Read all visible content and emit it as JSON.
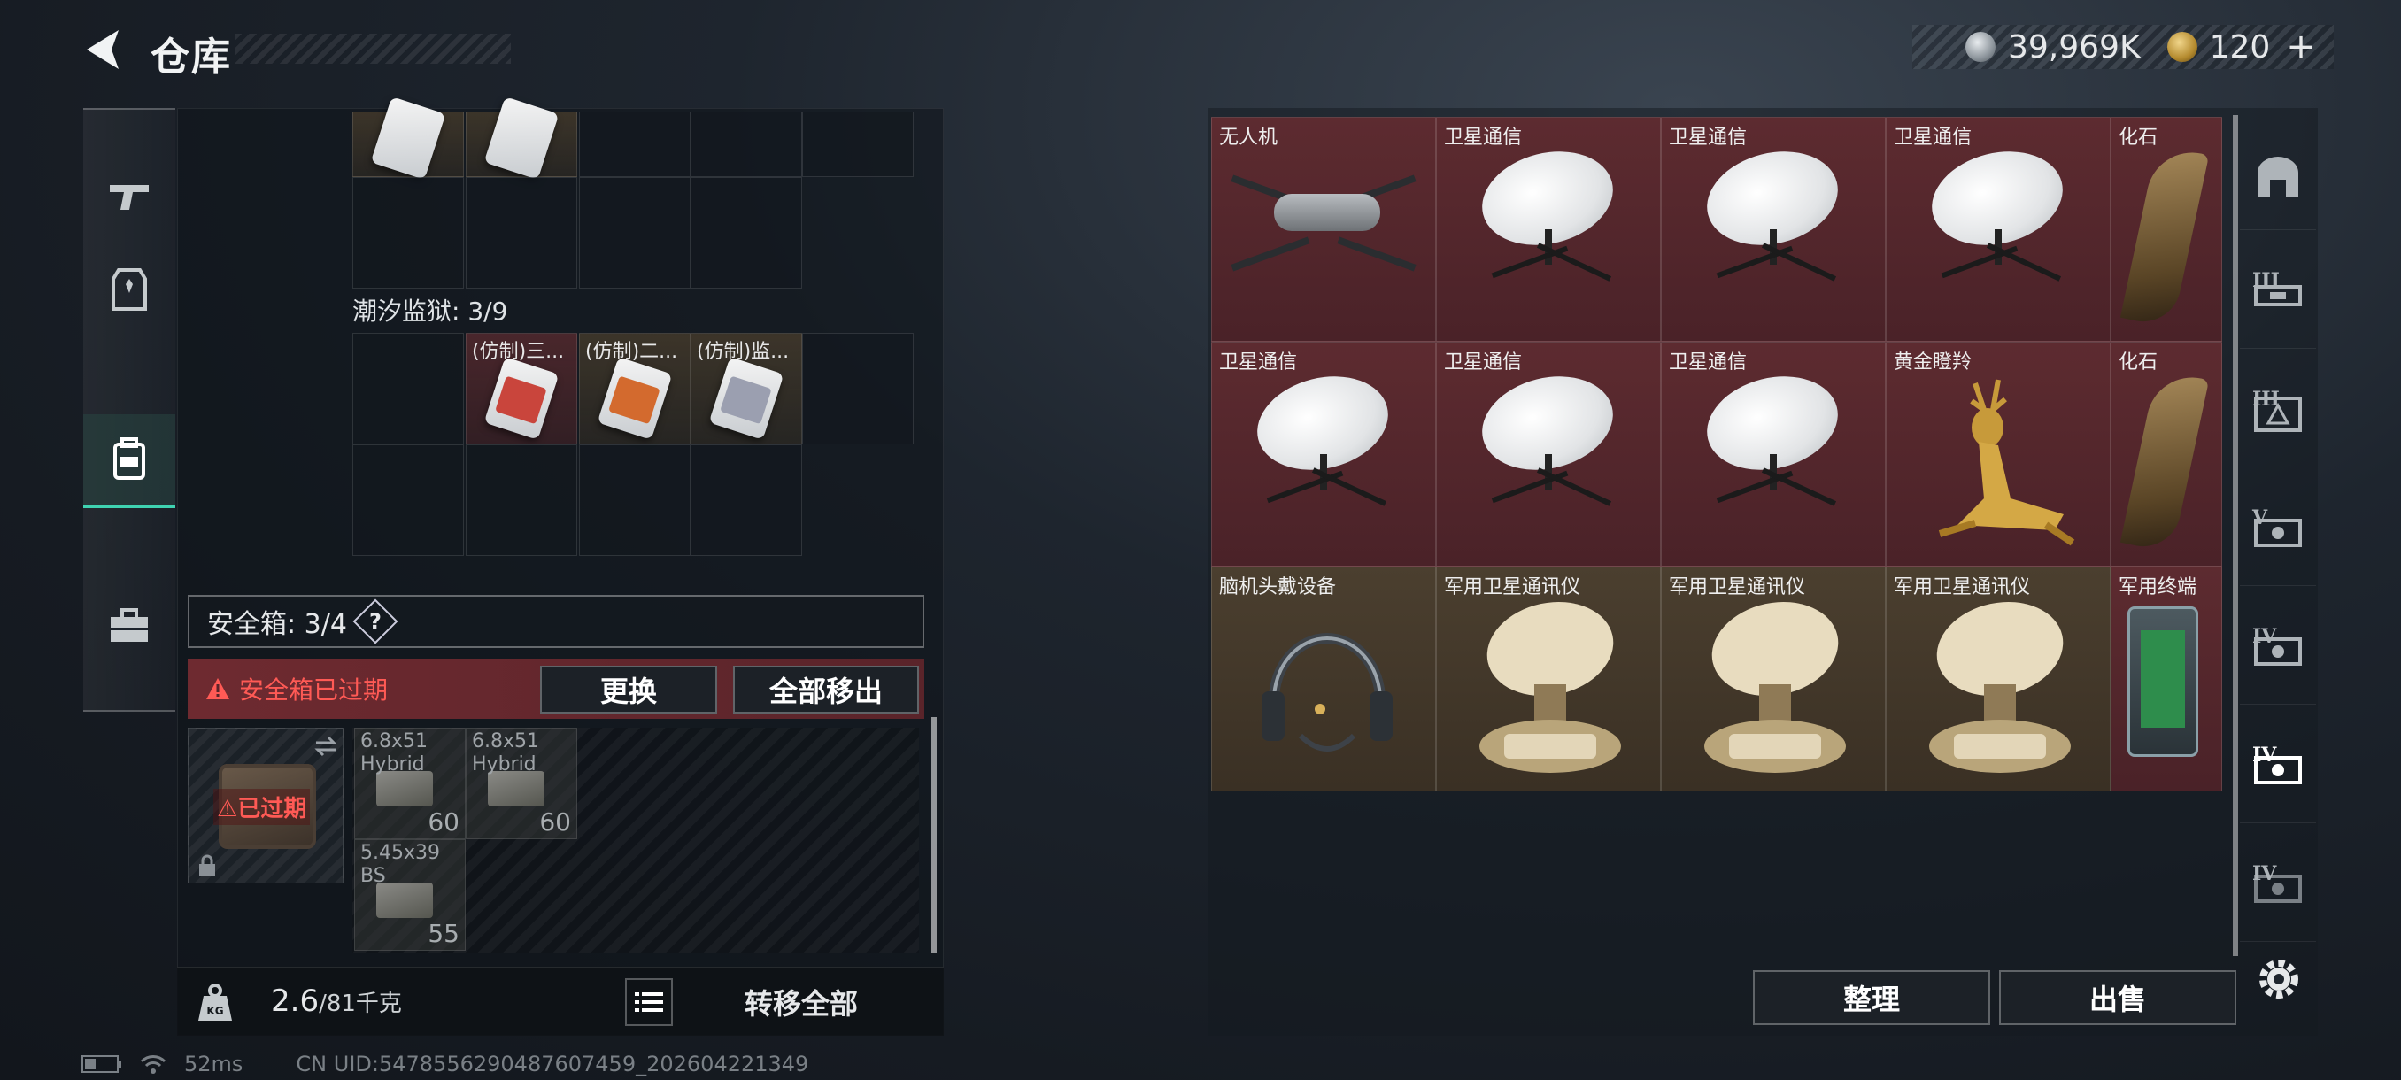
{
  "header": {
    "title": "仓库"
  },
  "currency": {
    "silver": "39,969K",
    "gold": "120"
  },
  "backpack": {
    "tide_prison_label": "潮汐监狱: 3/9",
    "tide_items": [
      "(仿制)三...",
      "(仿制)二...",
      "(仿制)监..."
    ],
    "safebox_label": "安全箱: 3/4",
    "help_label": "?",
    "expired_warning": "安全箱已过期",
    "replace_label": "更换",
    "move_all_out_label": "全部移出",
    "expired_tag": "已过期",
    "ammo": [
      {
        "name": "6.8x51\nHybrid",
        "count": "60"
      },
      {
        "name": "6.8x51\nHybrid",
        "count": "60"
      },
      {
        "name": "5.45x39\nBS",
        "count": "55"
      }
    ],
    "weight_value": "2.6",
    "weight_max": "/81千克",
    "transfer_all_label": "转移全部"
  },
  "status": {
    "ping": "52ms",
    "uid": "CN UID:5478556290487607459_202604221349"
  },
  "warehouse": {
    "items": [
      {
        "name": "无人机"
      },
      {
        "name": "卫星通信"
      },
      {
        "name": "卫星通信"
      },
      {
        "name": "卫星通信"
      },
      {
        "name": "化石"
      },
      {
        "name": "卫星通信"
      },
      {
        "name": "卫星通信"
      },
      {
        "name": "卫星通信"
      },
      {
        "name": "黄金瞪羚"
      },
      {
        "name": "化石"
      },
      {
        "name": "脑机头戴设备"
      },
      {
        "name": "军用卫星通讯仪"
      },
      {
        "name": "军用卫星通讯仪"
      },
      {
        "name": "军用卫星通讯仪"
      },
      {
        "name": "军用终端"
      }
    ],
    "tabs": [
      "",
      "III",
      "III",
      "V",
      "IV",
      "IV",
      "IV"
    ],
    "sort_label": "整理",
    "sell_label": "出售"
  },
  "colors": {
    "accent": "#3fd3b1",
    "warning": "#ff5a55",
    "rare_red": "#5d2b30",
    "rare_brown": "#4b3f2f"
  }
}
